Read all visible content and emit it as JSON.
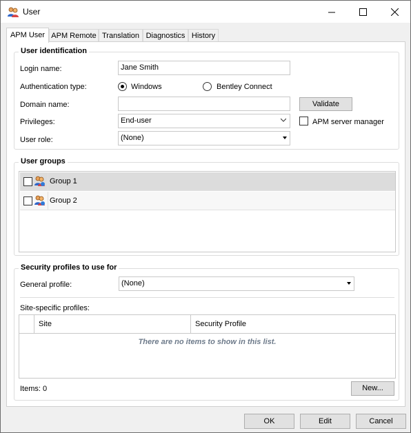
{
  "window": {
    "title": "User"
  },
  "tabs": [
    {
      "label": "APM User",
      "active": true
    },
    {
      "label": "APM Remote"
    },
    {
      "label": "Translation"
    },
    {
      "label": "Diagnostics"
    },
    {
      "label": "History"
    }
  ],
  "identification": {
    "title": "User identification",
    "login_label": "Login name:",
    "login_value": "Jane Smith",
    "auth_label": "Authentication type:",
    "auth_windows": "Windows",
    "auth_bentley": "Bentley Connect",
    "auth_selected": "Windows",
    "domain_label": "Domain name:",
    "domain_value": "",
    "validate_button": "Validate",
    "privileges_label": "Privileges:",
    "privileges_value": "End-user",
    "apm_server_manager": "APM server manager",
    "apm_server_manager_checked": false,
    "role_label": "User role:",
    "role_value": "(None)"
  },
  "groups": {
    "title": "User groups",
    "items": [
      {
        "label": "Group 1",
        "checked": false
      },
      {
        "label": "Group 2",
        "checked": false
      }
    ]
  },
  "security": {
    "title": "Security profiles to use for",
    "general_label": "General profile:",
    "general_value": "(None)",
    "site_specific_label": "Site-specific profiles:",
    "columns": [
      "Site",
      "Security Profile"
    ],
    "empty_message": "There are no items to show in this list.",
    "items_count": "Items: 0",
    "new_button": "New..."
  },
  "footer": {
    "ok": "OK",
    "edit": "Edit",
    "cancel": "Cancel"
  }
}
